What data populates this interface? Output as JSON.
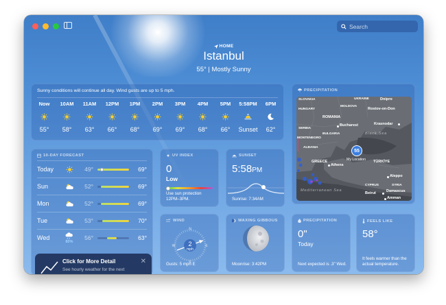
{
  "window": {
    "search_placeholder": "Search"
  },
  "header": {
    "home_label": "HOME",
    "city": "Istanbul",
    "temp_condition": "55°  |  Mostly Sunny"
  },
  "hourly": {
    "summary": "Sunny conditions will continue all day. Wind gusts are up to 5 mph.",
    "hours": [
      {
        "time": "Now",
        "icon": "sun-icon",
        "temp": "55°"
      },
      {
        "time": "10AM",
        "icon": "sun-icon",
        "temp": "58°"
      },
      {
        "time": "11AM",
        "icon": "sun-icon",
        "temp": "63°"
      },
      {
        "time": "12PM",
        "icon": "sun-icon",
        "temp": "66°"
      },
      {
        "time": "1PM",
        "icon": "sun-icon",
        "temp": "68°"
      },
      {
        "time": "2PM",
        "icon": "sun-icon",
        "temp": "69°"
      },
      {
        "time": "3PM",
        "icon": "sun-icon",
        "temp": "69°"
      },
      {
        "time": "4PM",
        "icon": "sun-icon",
        "temp": "68°"
      },
      {
        "time": "5PM",
        "icon": "sun-icon",
        "temp": "66°"
      },
      {
        "time": "5:58PM",
        "icon": "sunset-icon",
        "temp": "Sunset"
      },
      {
        "time": "6PM",
        "icon": "moon-icon",
        "temp": "62°"
      }
    ]
  },
  "tenday": {
    "title": "10-DAY FORECAST",
    "days": [
      {
        "day": "Today",
        "icon": "sun-icon",
        "pop": "",
        "low": "49°",
        "high": "69°",
        "bar_start": 0.0,
        "bar_end": 1.0,
        "current": 0.15
      },
      {
        "day": "Sun",
        "icon": "partly-cloudy-icon",
        "pop": "",
        "low": "52°",
        "high": "69°",
        "bar_start": 0.1,
        "bar_end": 1.0,
        "current": null
      },
      {
        "day": "Mon",
        "icon": "partly-cloudy-icon",
        "pop": "",
        "low": "52°",
        "high": "69°",
        "bar_start": 0.1,
        "bar_end": 1.0,
        "current": null
      },
      {
        "day": "Tue",
        "icon": "partly-cloudy-icon",
        "pop": "",
        "low": "53°",
        "high": "70°",
        "bar_start": 0.15,
        "bar_end": 1.0,
        "current": null
      },
      {
        "day": "Wed",
        "icon": "rain-cloud-icon",
        "pop": "80%",
        "low": "56°",
        "high": "63°",
        "bar_start": 0.3,
        "bar_end": 0.6,
        "current": null
      }
    ]
  },
  "tooltip": {
    "title": "Click for More Detail",
    "subtitle": "See hourly weather for the next"
  },
  "precipitation_map": {
    "title": "PRECIPITATION",
    "labels": {
      "slovakia": "SLOVAKIA",
      "ukraine": "UKRAINE",
      "dnipro": "Dnipro",
      "hungary": "HUNGARY",
      "moldova": "MOLDOVA",
      "rostov": "Rostov-on-Don",
      "romania": "ROMANIA",
      "bucharest": "Bucharest",
      "krasnodar": "Krasnodar",
      "serbia": "SERBIA",
      "bulgaria": "BULGARIA",
      "montenegro": "MONTENEGRO",
      "black_sea": "Black Sea",
      "albania": "ALBANIA",
      "greece": "GREECE",
      "athens": "Athens",
      "turkiye": "TÜRKİYE",
      "my_location": "My Location",
      "location_temp": "55",
      "aleppo": "Aleppo",
      "cyprus": "CYPRUS",
      "syria": "SYRIA",
      "beirut": "Beirut",
      "damascus": "Damascus",
      "amman": "Amman",
      "med_sea": "Mediterranean Sea"
    }
  },
  "uv": {
    "title": "UV INDEX",
    "value": "0",
    "level": "Low",
    "note": "Use sun protection 12PM–3PM.",
    "index_fraction": 0.0
  },
  "sunset": {
    "title": "SUNSET",
    "time": "5:58",
    "ampm": "PM",
    "note": "Sunrise: 7:34AM"
  },
  "wind": {
    "title": "WIND",
    "speed": "2",
    "unit": "mph",
    "n": "N",
    "e": "E",
    "s": "S",
    "w": "W",
    "note": "Gusts: 5 mph E"
  },
  "moon": {
    "title": "WAXING GIBBOUS",
    "note": "Moonrise: 3:42PM"
  },
  "precip": {
    "title": "PRECIPITATION",
    "value": "0\"",
    "period": "Today",
    "note": "Next expected is .3\" Wed."
  },
  "feels": {
    "title": "FEELS LIKE",
    "value": "58°",
    "note": "It feels warmer than the actual temperature."
  },
  "colors": {
    "sky_top": "#3f7ec8",
    "sky_bottom": "#8bbbee",
    "sun": "#f8cf2c",
    "location_dot": "#3a7ee0"
  }
}
